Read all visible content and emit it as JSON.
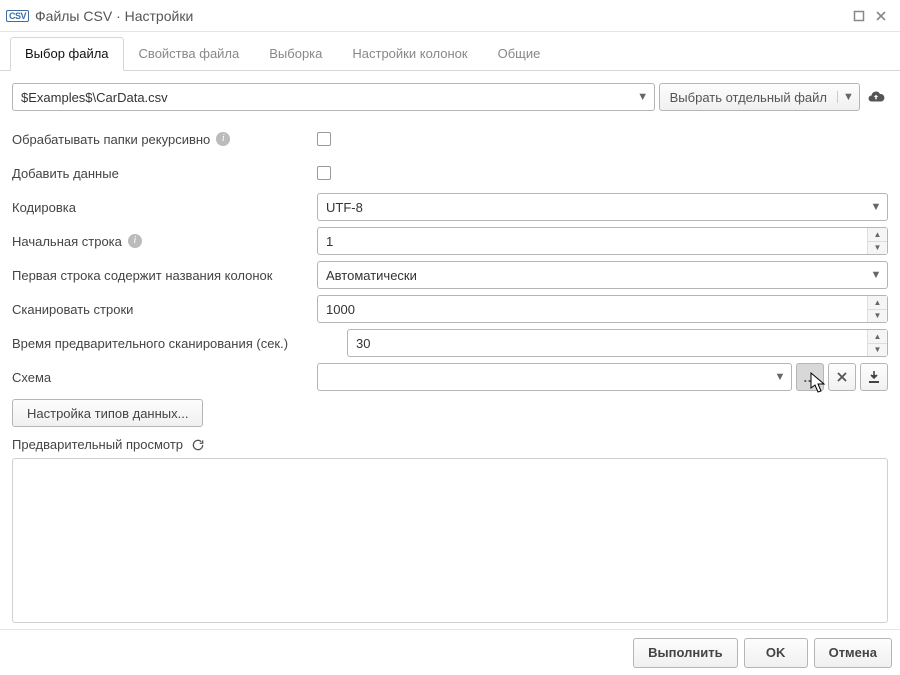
{
  "title": "Файлы CSV · Настройки",
  "titlebar_badge": "CSV",
  "tabs": [
    {
      "label": "Выбор файла",
      "active": true
    },
    {
      "label": "Свойства файла",
      "active": false
    },
    {
      "label": "Выборка",
      "active": false
    },
    {
      "label": "Настройки колонок",
      "active": false
    },
    {
      "label": "Общие",
      "active": false
    }
  ],
  "file_path": "$Examples$\\CarData.csv",
  "select_file_button": "Выбрать отдельный файл",
  "fields": {
    "recursive_label": "Обрабатывать папки рекурсивно",
    "append_label": "Добавить данные",
    "encoding_label": "Кодировка",
    "encoding_value": "UTF-8",
    "start_line_label": "Начальная строка",
    "start_line_value": "1",
    "first_row_label": "Первая строка содержит названия колонок",
    "first_row_value": "Автоматически",
    "scan_rows_label": "Сканировать строки",
    "scan_rows_value": "1000",
    "prescan_time_label": "Время предварительного сканирования (сек.)",
    "prescan_time_value": "30",
    "schema_label": "Схема",
    "schema_value": ""
  },
  "datatype_button": "Настройка типов данных...",
  "preview_label": "Предварительный просмотр",
  "footer": {
    "run": "Выполнить",
    "ok": "OK",
    "cancel": "Отмена"
  }
}
